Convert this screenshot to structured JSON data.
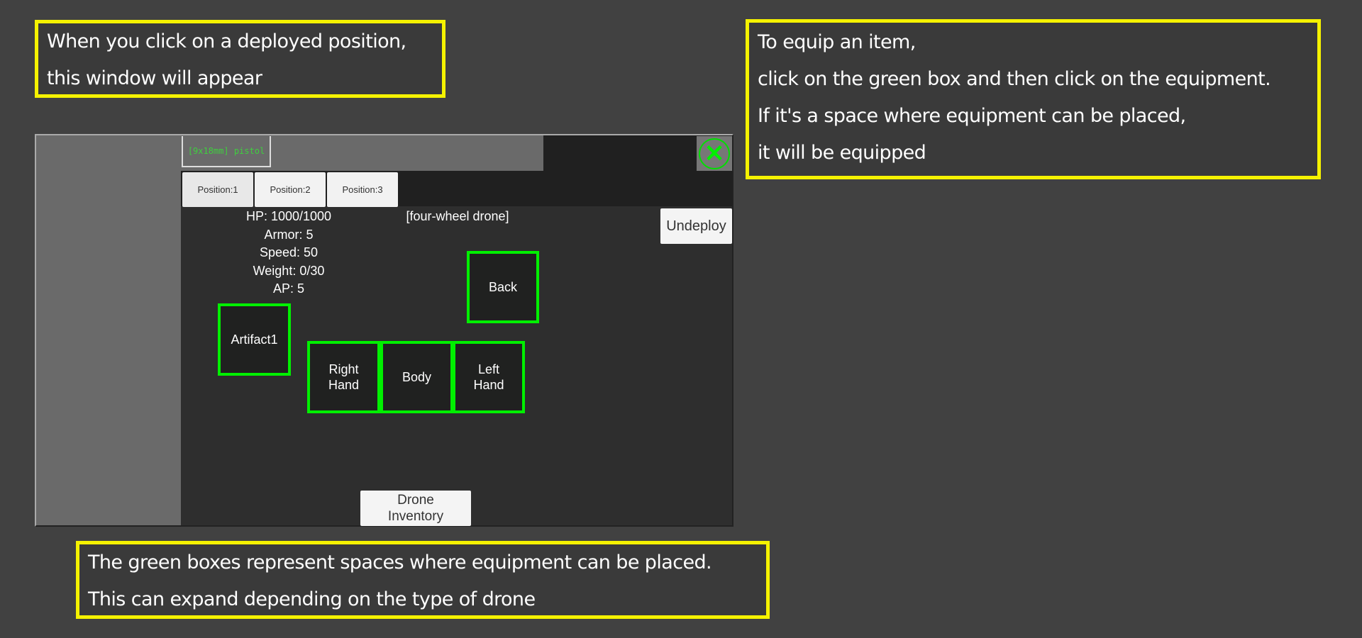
{
  "notes": {
    "deploy": [
      "When you click on a deployed position,",
      "this window will appear"
    ],
    "equip": [
      "To equip an item,",
      "click on the green box and then click on the equipment.",
      "If it's a space where equipment can be placed,",
      "it will be equipped"
    ],
    "green_boxes": [
      "The green boxes represent spaces where equipment can be placed.",
      "This can expand depending on the type of drone"
    ]
  },
  "window": {
    "item_tab": "[9x18mm] pistol",
    "close_icon": "close-x",
    "positions": [
      "Position:1",
      "Position:2",
      "Position:3"
    ],
    "stats": [
      "HP: 1000/1000",
      "Armor: 5",
      "Speed: 50",
      "Weight: 0/30",
      "AP: 5"
    ],
    "drone_type": "[four-wheel drone]",
    "undeploy": "Undeploy",
    "slots": {
      "back": "Back",
      "artifact1": "Artifact1",
      "right_hand": "Right\nHand",
      "body": "Body",
      "left_hand": "Left\nHand"
    },
    "drone_inventory": "Drone\nInventory"
  },
  "colors": {
    "annotation_border": "#f5f200",
    "slot_border": "#00f000",
    "item_text": "#3fcf3f"
  }
}
